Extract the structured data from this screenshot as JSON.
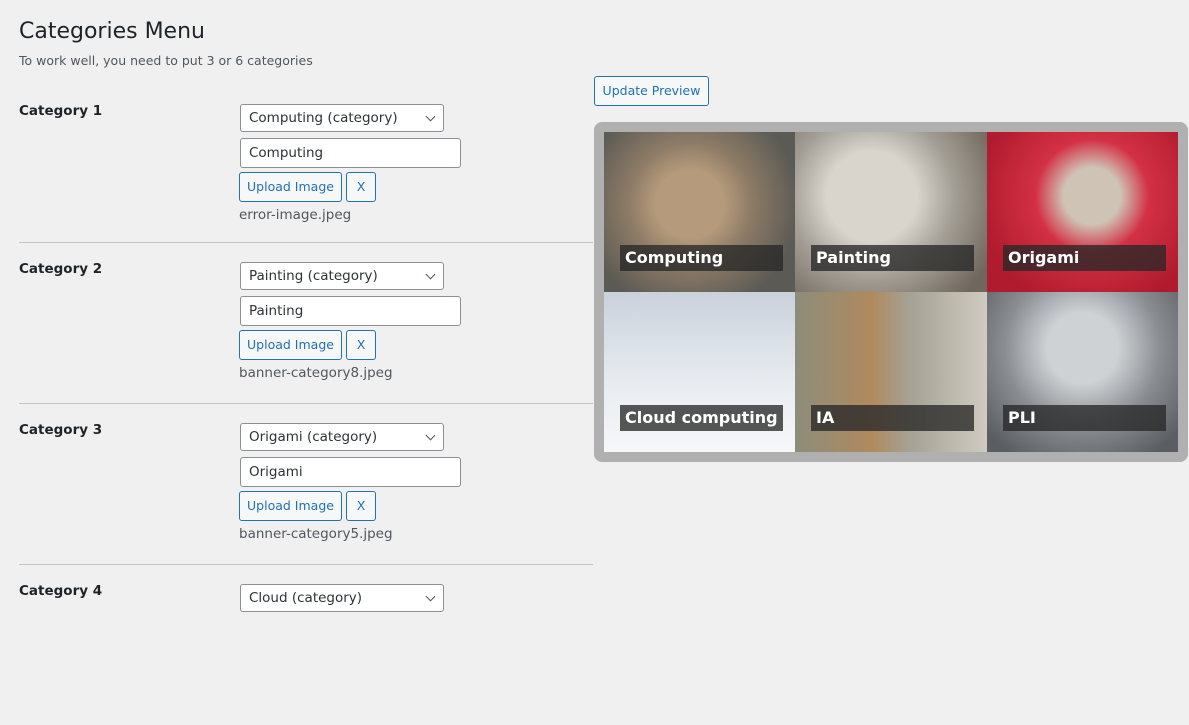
{
  "page": {
    "title": "Categories Menu",
    "description": "To work well, you need to put 3 or 6 categories"
  },
  "categories": [
    {
      "label": "Category 1",
      "select": "Computing (category)",
      "title": "Computing",
      "upload": "Upload Image",
      "clear": "X",
      "file": "error-image.jpeg"
    },
    {
      "label": "Category 2",
      "select": "Painting (category)",
      "title": "Painting",
      "upload": "Upload Image",
      "clear": "X",
      "file": "banner-category8.jpeg"
    },
    {
      "label": "Category 3",
      "select": "Origami (category)",
      "title": "Origami",
      "upload": "Upload Image",
      "clear": "X",
      "file": "banner-category5.jpeg"
    },
    {
      "label": "Category 4",
      "select": "Cloud (category)"
    }
  ],
  "preview": {
    "update_label": "Update Preview",
    "tiles": [
      "Computing",
      "Painting",
      "Origami",
      "Cloud computing",
      "IA",
      "PLI"
    ]
  }
}
